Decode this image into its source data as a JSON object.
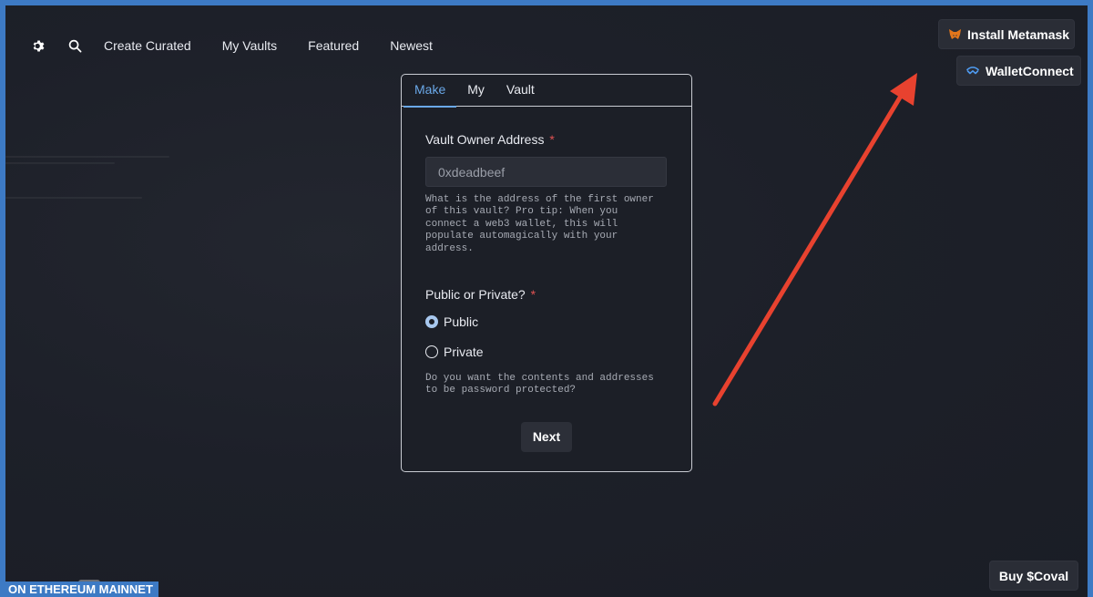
{
  "nav": {
    "settings_icon": "gear-icon",
    "search_icon": "search-icon",
    "links": [
      "Create Curated",
      "My Vaults",
      "Featured",
      "Newest"
    ]
  },
  "wallet": {
    "metamask_label": "Install Metamask",
    "metamask_icon": "fox-icon",
    "walletconnect_label": "WalletConnect",
    "walletconnect_icon": "walletconnect-icon"
  },
  "card": {
    "tabs": [
      "Make",
      "My",
      "Vault"
    ],
    "active_tab": "Make",
    "owner_label": "Vault Owner Address",
    "required_mark": "*",
    "owner_placeholder": "0xdeadbeef",
    "owner_help": "What is the address of the first owner of this vault? Pro tip: When you connect a web3 wallet, this will populate automagically with your address.",
    "visibility_label": "Public or Private?",
    "options": [
      "Public",
      "Private"
    ],
    "selected_option": "Public",
    "visibility_help": "Do you want the contents and addresses to be password protected?",
    "next_label": "Next"
  },
  "footer": {
    "buy_label": "Buy $Coval",
    "network_label": "ON ETHEREUM MAINNET"
  },
  "colors": {
    "accent": "#6aa8e8",
    "annotation_arrow": "#e8422f",
    "frame": "#3d7ac4"
  }
}
